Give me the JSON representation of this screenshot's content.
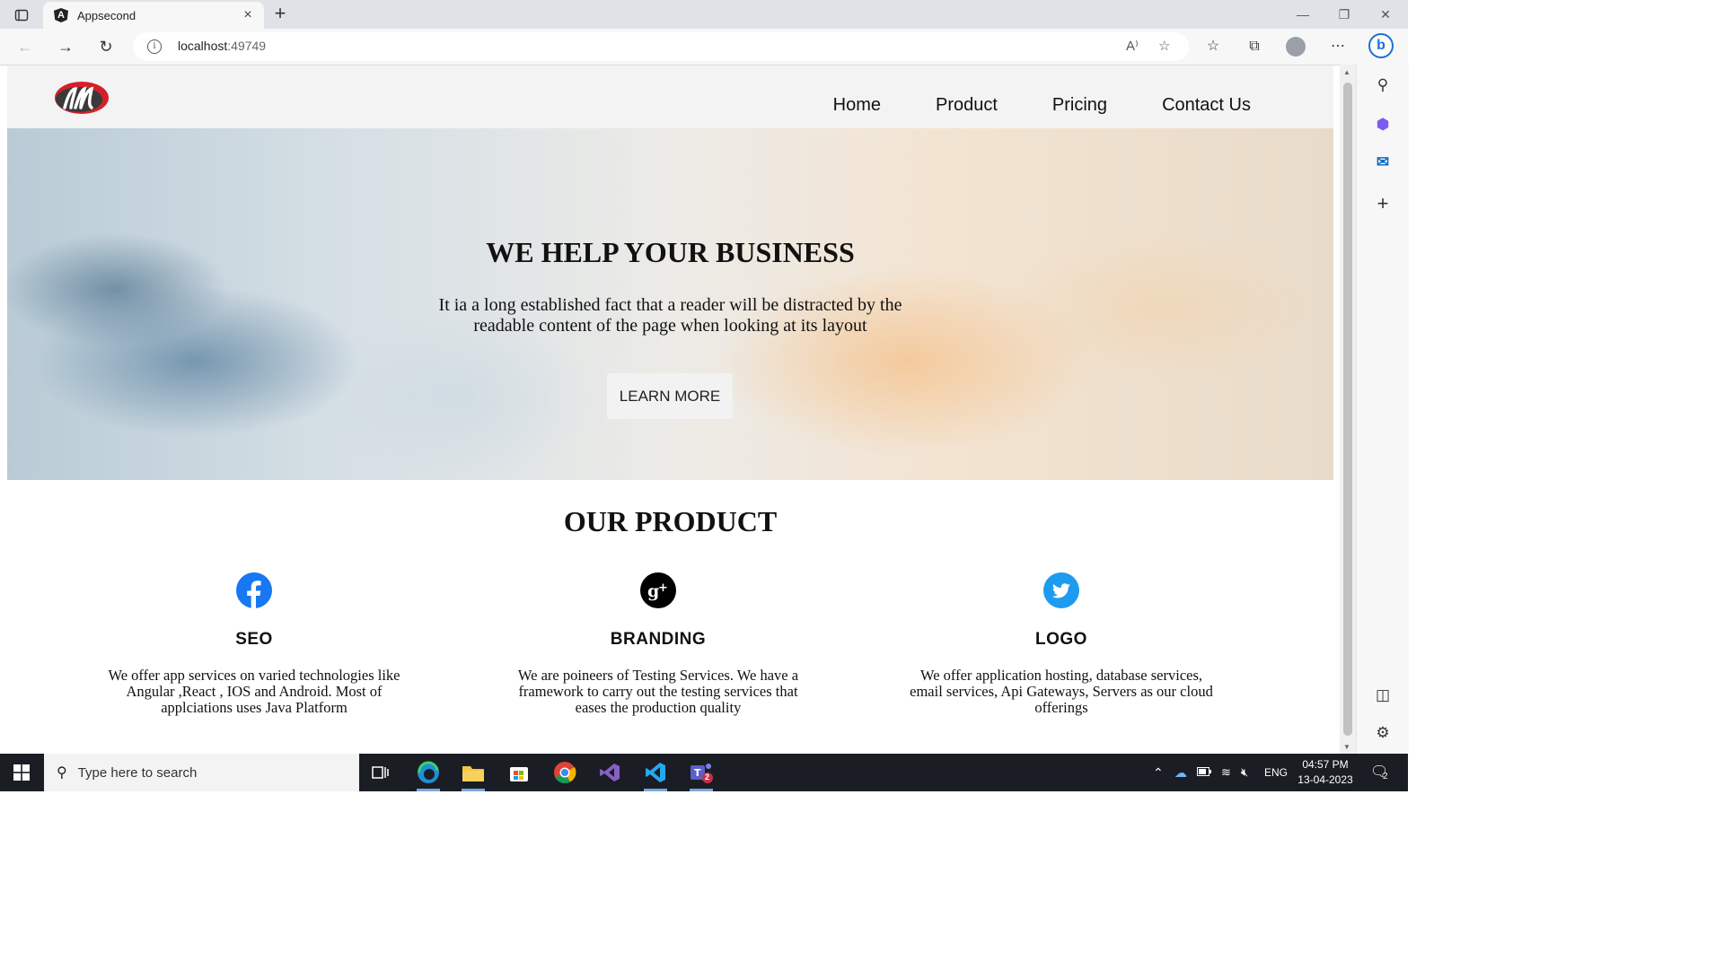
{
  "browser": {
    "tab_title": "Appsecond",
    "tab_close": "×",
    "new_tab": "+",
    "url_host": "localhost",
    "url_port": ":49749"
  },
  "site": {
    "nav": [
      "Home",
      "Product",
      "Pricing",
      "Contact Us"
    ],
    "hero": {
      "title": "WE HELP YOUR BUSINESS",
      "subtitle": "It ia a long established fact that a reader will be distracted by the readable content of the page when looking at its layout",
      "button": "LEARN MORE"
    },
    "products_title": "OUR PRODUCT",
    "products": [
      {
        "title": "SEO",
        "text": "We offer app services on varied technologies like Angular ,React , IOS and Android. Most of applciations uses Java Platform",
        "icon": "facebook-icon",
        "color": "#1877f2"
      },
      {
        "title": "BRANDING",
        "text": "We are poineers of Testing Services. We have a framework to carry out the testing services that eases the production quality",
        "icon": "google-plus-icon",
        "color": "#000000"
      },
      {
        "title": "LOGO",
        "text": "We offer application hosting, database services, email services, Api Gateways, Servers as our cloud offerings",
        "icon": "twitter-icon",
        "color": "#1d9bf0"
      }
    ]
  },
  "taskbar": {
    "search_placeholder": "Type here to search",
    "lang": "ENG",
    "time": "04:57 PM",
    "date": "13-04-2023",
    "notification_count": "2",
    "teams_badge": "2"
  }
}
